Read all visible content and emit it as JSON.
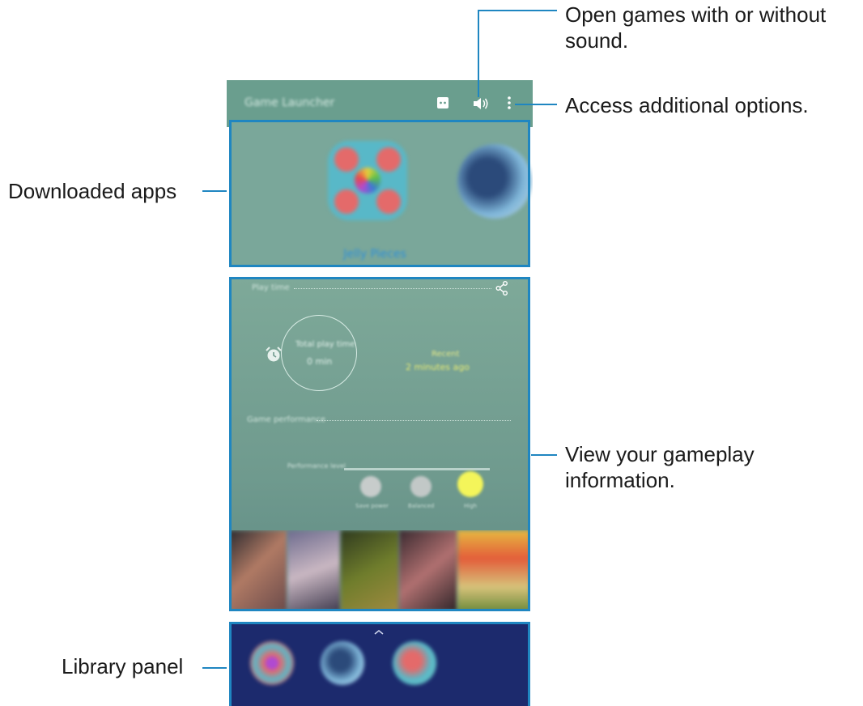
{
  "app": {
    "title": "Game Launcher",
    "accent_color": "#6a9e8e",
    "highlight_color": "#1f86c1"
  },
  "appbar": {
    "icons": [
      "discord-icon",
      "sound-icon",
      "more-options-icon"
    ]
  },
  "downloaded_apps": {
    "featured_game": "Jelly Pieces",
    "games": [
      "Jelly Pieces",
      "Second game"
    ]
  },
  "gameplay": {
    "play_time_label": "Play time",
    "total_label": "Total play time",
    "total_value": "0 min",
    "recent_label": "Recent",
    "recent_value": "2 minutes ago",
    "performance_label": "Game performance",
    "slider_label": "Performance level",
    "slider_options": [
      "Save power",
      "Balanced",
      "High"
    ],
    "selected_option": "High"
  },
  "callouts": {
    "sound": "Open games with or without sound.",
    "options": "Access additional options.",
    "downloaded": "Downloaded apps",
    "gameplay": "View your gameplay information.",
    "library": "Library panel"
  }
}
